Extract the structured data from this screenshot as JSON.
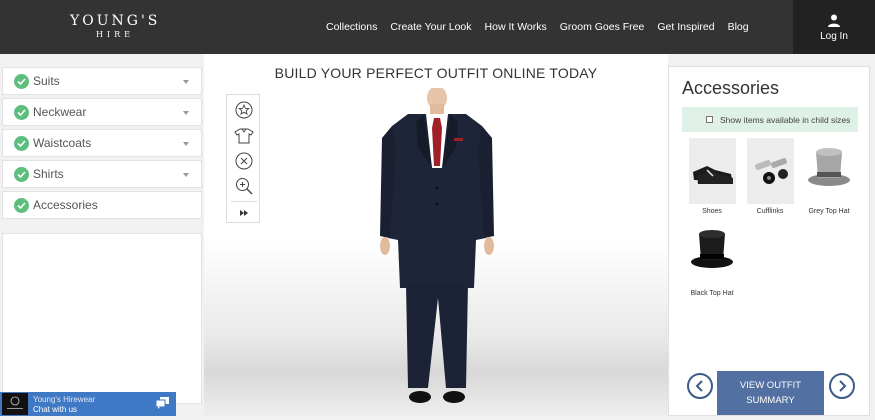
{
  "brand": {
    "name": "YOUNG'S",
    "sub": "HIRE"
  },
  "nav": [
    "Collections",
    "Create Your Look",
    "How It Works",
    "Groom Goes Free",
    "Get Inspired",
    "Blog"
  ],
  "login": {
    "label": "Log In",
    "icon": "user-icon"
  },
  "categories": [
    {
      "label": "Suits",
      "checked": true,
      "expandable": true
    },
    {
      "label": "Neckwear",
      "checked": true,
      "expandable": true
    },
    {
      "label": "Waistcoats",
      "checked": true,
      "expandable": true
    },
    {
      "label": "Shirts",
      "checked": true,
      "expandable": true
    },
    {
      "label": "Accessories",
      "checked": true,
      "expandable": false
    }
  ],
  "main": {
    "title": "BUILD YOUR PERFECT OUTFIT ONLINE TODAY"
  },
  "toolbar": [
    "star-icon",
    "shirt-icon",
    "close-circle-icon",
    "zoom-in-icon",
    "fast-forward-icon"
  ],
  "accessories": {
    "title": "Accessories",
    "child_sizes_label": "Show items available in child sizes",
    "child_sizes_checked": false,
    "items": [
      {
        "label": "Shoes"
      },
      {
        "label": "Cufflinks"
      },
      {
        "label": "Grey Top Hat"
      },
      {
        "label": "Black Top Hat"
      }
    ],
    "summary_button": "VIEW OUTFIT SUMMARY"
  },
  "chat": {
    "title": "Young's Hirewear",
    "subtitle": "Chat with us"
  },
  "colors": {
    "header": "#333333",
    "check": "#5dbe7e",
    "summary_button": "#5270a1",
    "chat": "#3f78c4",
    "suit": "#1e2538",
    "tie": "#a0202a"
  }
}
